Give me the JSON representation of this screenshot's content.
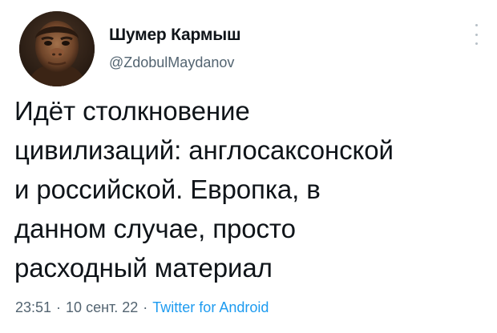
{
  "user": {
    "display_name": "Шумер Кармыш",
    "handle": "@ZdobulMaydanov"
  },
  "tweet": {
    "text": "Идёт столкновение\nцивилизаций: англосаксонской\nи российской. Европка, в\nданном случае, просто\nрасходный материал"
  },
  "meta": {
    "time": "23:51",
    "separator": "·",
    "date": "10 сент. 22",
    "source": "Twitter for Android"
  },
  "icons": {
    "more": "more-vertical-icon",
    "avatar": "avatar"
  },
  "colors": {
    "secondary_text": "#536471",
    "link": "#1d9bf0",
    "primary_text": "#0f1419"
  }
}
